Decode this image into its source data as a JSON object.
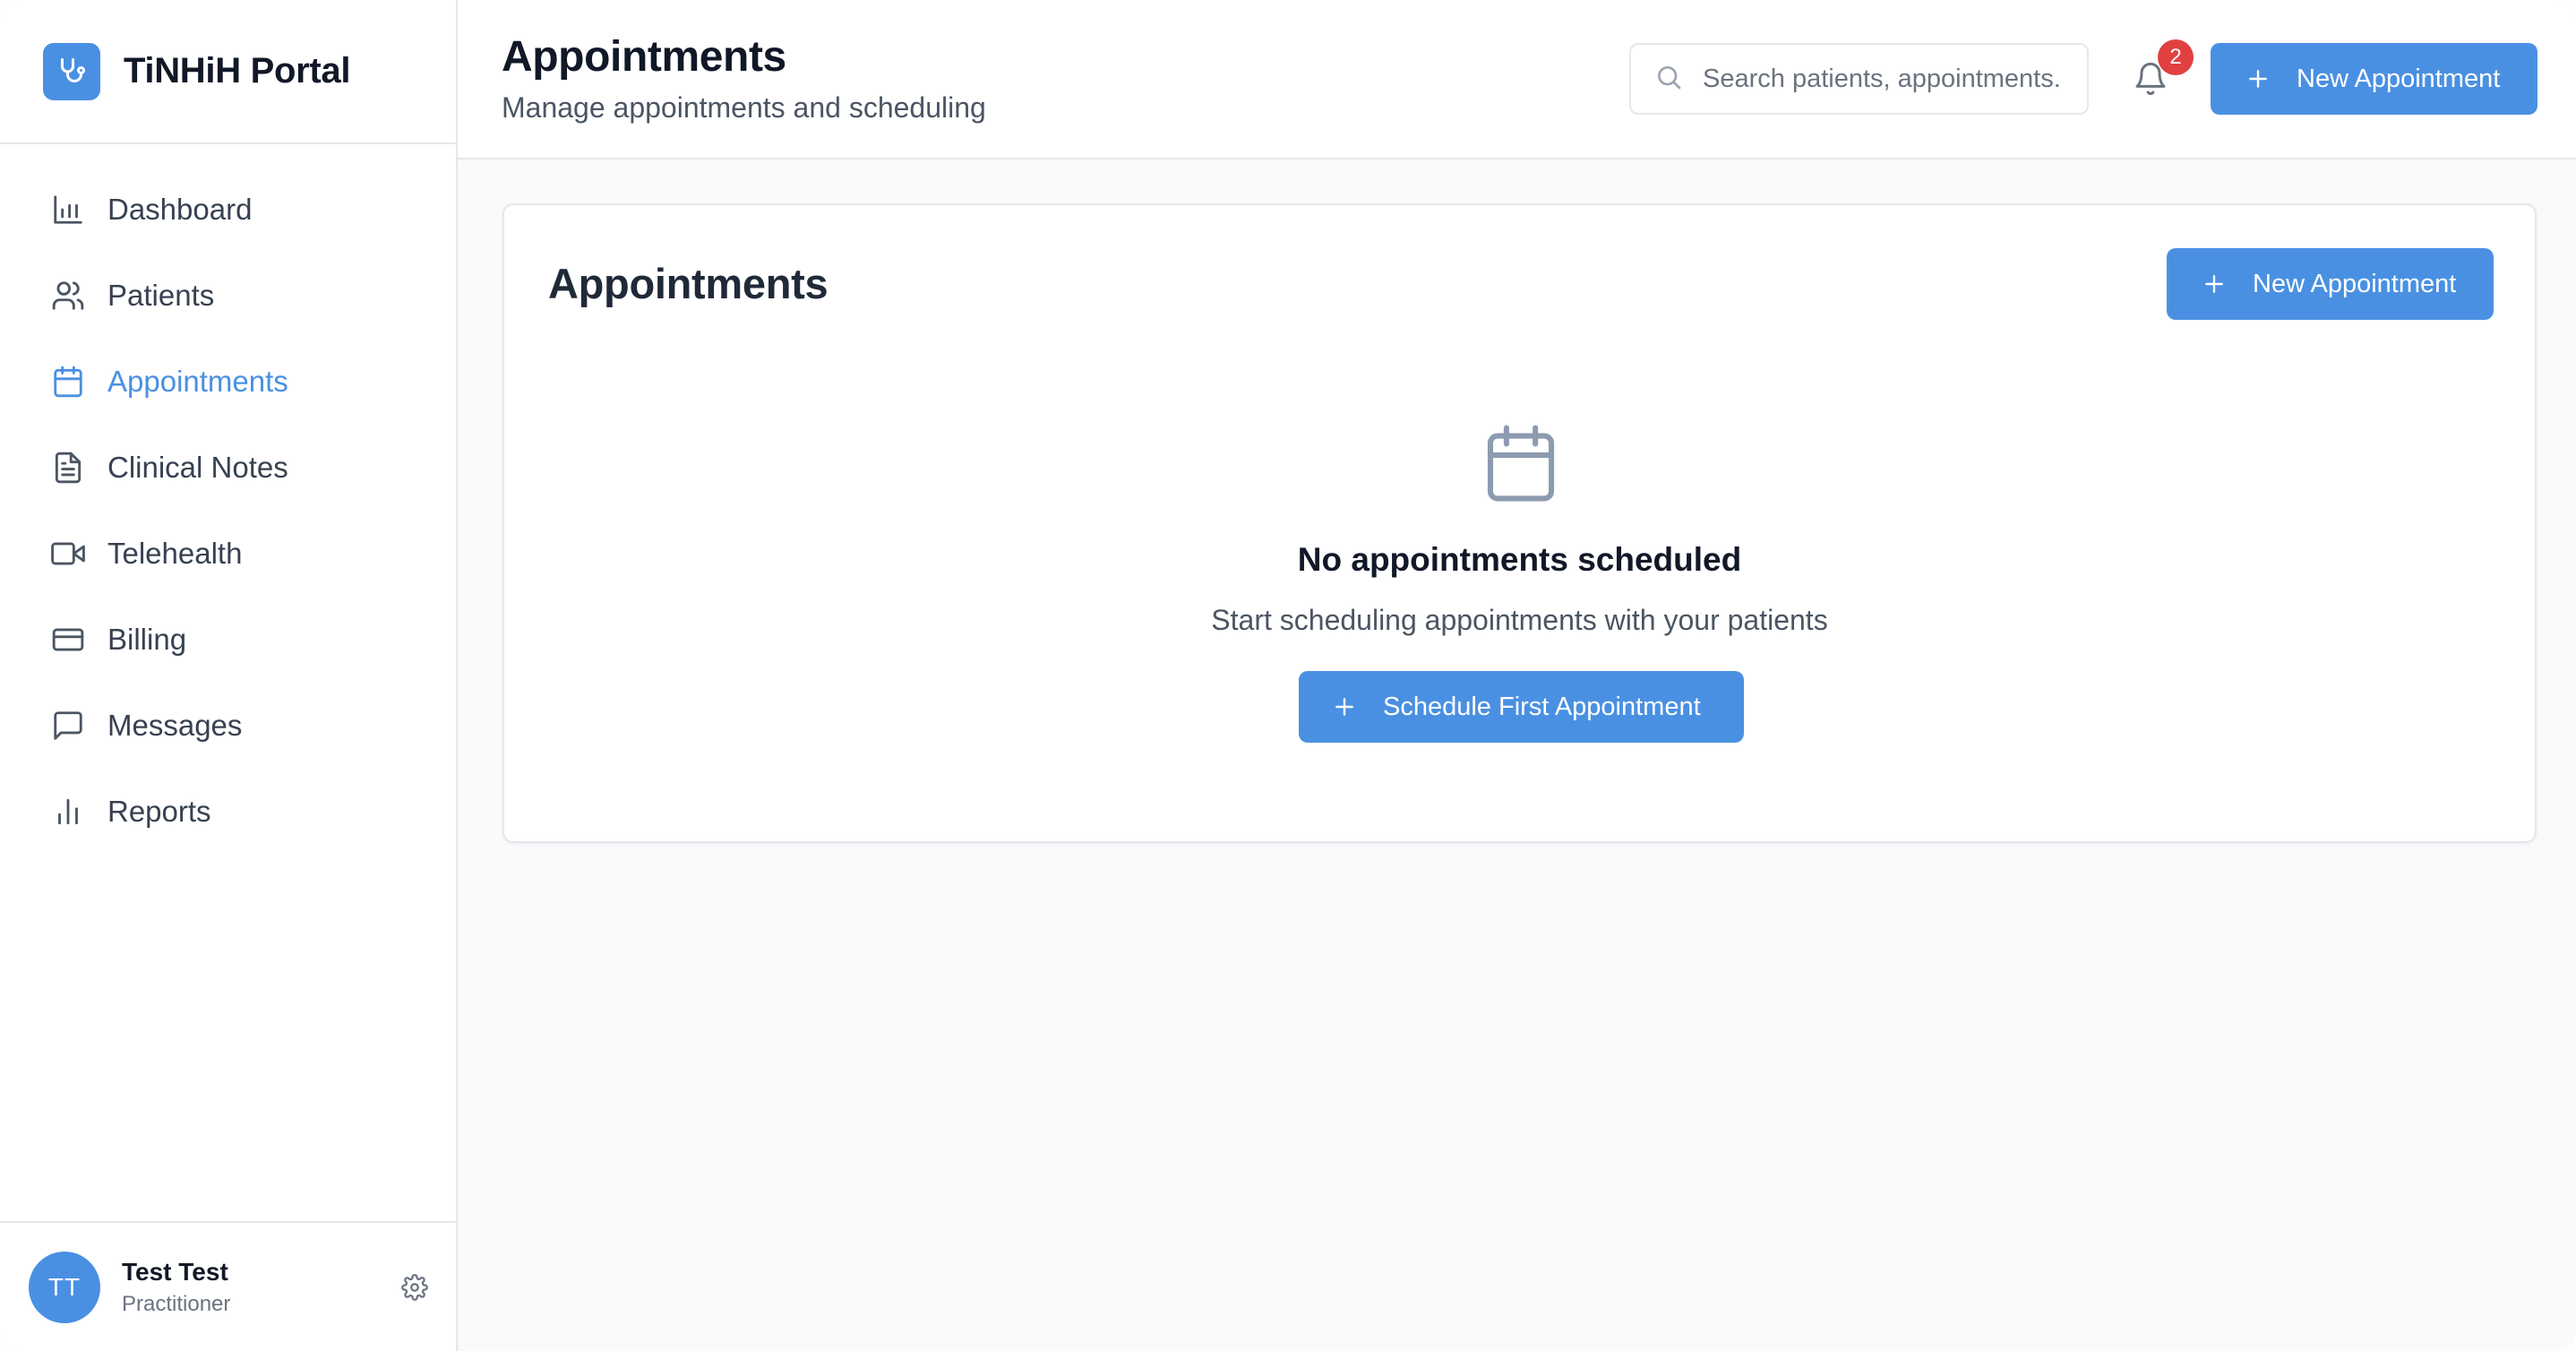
{
  "app": {
    "name": "TiNHiH Portal",
    "accent": "#4a90e2"
  },
  "sidebar": {
    "items": [
      {
        "label": "Dashboard",
        "icon": "bar-chart-icon",
        "active": false
      },
      {
        "label": "Patients",
        "icon": "users-icon",
        "active": false
      },
      {
        "label": "Appointments",
        "icon": "calendar-icon",
        "active": true
      },
      {
        "label": "Clinical Notes",
        "icon": "document-icon",
        "active": false
      },
      {
        "label": "Telehealth",
        "icon": "video-icon",
        "active": false
      },
      {
        "label": "Billing",
        "icon": "credit-card-icon",
        "active": false
      },
      {
        "label": "Messages",
        "icon": "message-icon",
        "active": false
      },
      {
        "label": "Reports",
        "icon": "bar-chart-small-icon",
        "active": false
      }
    ],
    "user": {
      "initials": "TT",
      "name": "Test Test",
      "role": "Practitioner"
    }
  },
  "header": {
    "title": "Appointments",
    "subtitle": "Manage appointments and scheduling",
    "search_placeholder": "Search patients, appointments...",
    "notification_count": "2",
    "new_button": "New Appointment"
  },
  "card": {
    "title": "Appointments",
    "new_button": "New Appointment",
    "empty_title": "No appointments scheduled",
    "empty_subtitle": "Start scheduling appointments with your patients",
    "schedule_button": "Schedule First Appointment"
  }
}
